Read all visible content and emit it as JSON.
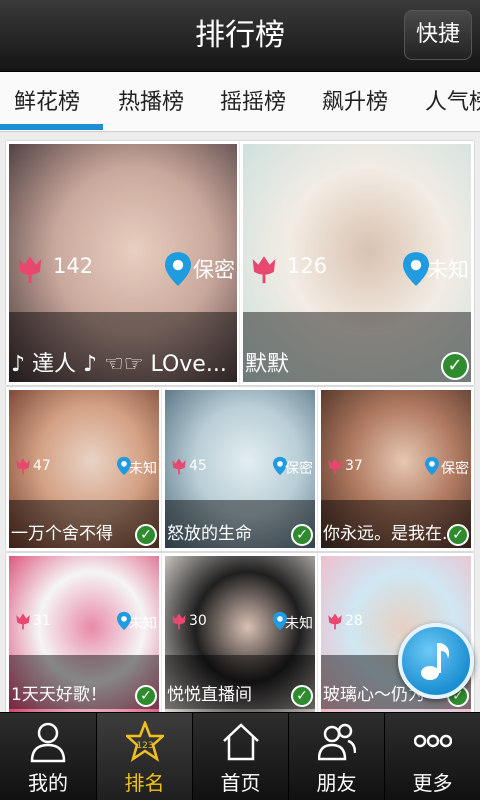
{
  "header": {
    "title": "排行榜",
    "quick_label": "快捷"
  },
  "tabs": [
    "鲜花榜",
    "热播榜",
    "摇摇榜",
    "飙升榜",
    "人气榜"
  ],
  "active_tab": "鲜花榜",
  "cards": [
    {
      "flowers": "142",
      "location": "保密",
      "name": "♪ 達人 ♪ ☜☞ LOve...",
      "verified": false,
      "photo_colors": [
        "#3c2f33",
        "#c9a89c",
        "#e8cfc0"
      ]
    },
    {
      "flowers": "126",
      "location": "未知",
      "name": "默默",
      "verified": true,
      "photo_colors": [
        "#c8dfdd",
        "#f2ece4",
        "#d9c2b0"
      ]
    },
    {
      "flowers": "47",
      "location": "未知",
      "name": "一万个舍不得",
      "verified": true,
      "photo_colors": [
        "#6d3b2b",
        "#d4a184",
        "#e9d3c5"
      ]
    },
    {
      "flowers": "45",
      "location": "保密",
      "name": "怒放的生命",
      "verified": true,
      "photo_colors": [
        "#4f6a7c",
        "#b9ced6",
        "#e3eef0"
      ]
    },
    {
      "flowers": "37",
      "location": "保密",
      "name": "你永远。是我在...",
      "verified": true,
      "photo_colors": [
        "#4a2e25",
        "#b07a60",
        "#e6c7b2"
      ]
    },
    {
      "flowers": "31",
      "location": "未知",
      "name": "1天天好歌！",
      "verified": true,
      "photo_colors": [
        "#d83c6a",
        "#f5f5f5",
        "#e88aa8"
      ]
    },
    {
      "flowers": "30",
      "location": "未知",
      "name": "悦悦直播间",
      "verified": true,
      "photo_colors": [
        "#e7e2dc",
        "#1f1f1f",
        "#d9c0b4"
      ]
    },
    {
      "flowers": "28",
      "location": "",
      "name": "玻璃心～仍为",
      "verified": true,
      "photo_colors": [
        "#f4b7c6",
        "#cfe7f2",
        "#e6d0c2"
      ]
    }
  ],
  "nav": [
    {
      "label": "我的",
      "icon": "person-icon",
      "active": false
    },
    {
      "label": "排名",
      "icon": "star-rank-icon",
      "active": true
    },
    {
      "label": "首页",
      "icon": "home-icon",
      "active": false
    },
    {
      "label": "朋友",
      "icon": "friends-icon",
      "active": false
    },
    {
      "label": "更多",
      "icon": "more-icon",
      "active": false
    }
  ],
  "colors": {
    "accent": "#1e8fd6",
    "flower": "#e8476f",
    "pin": "#1f9be0",
    "nav_active": "#f2c21a"
  }
}
